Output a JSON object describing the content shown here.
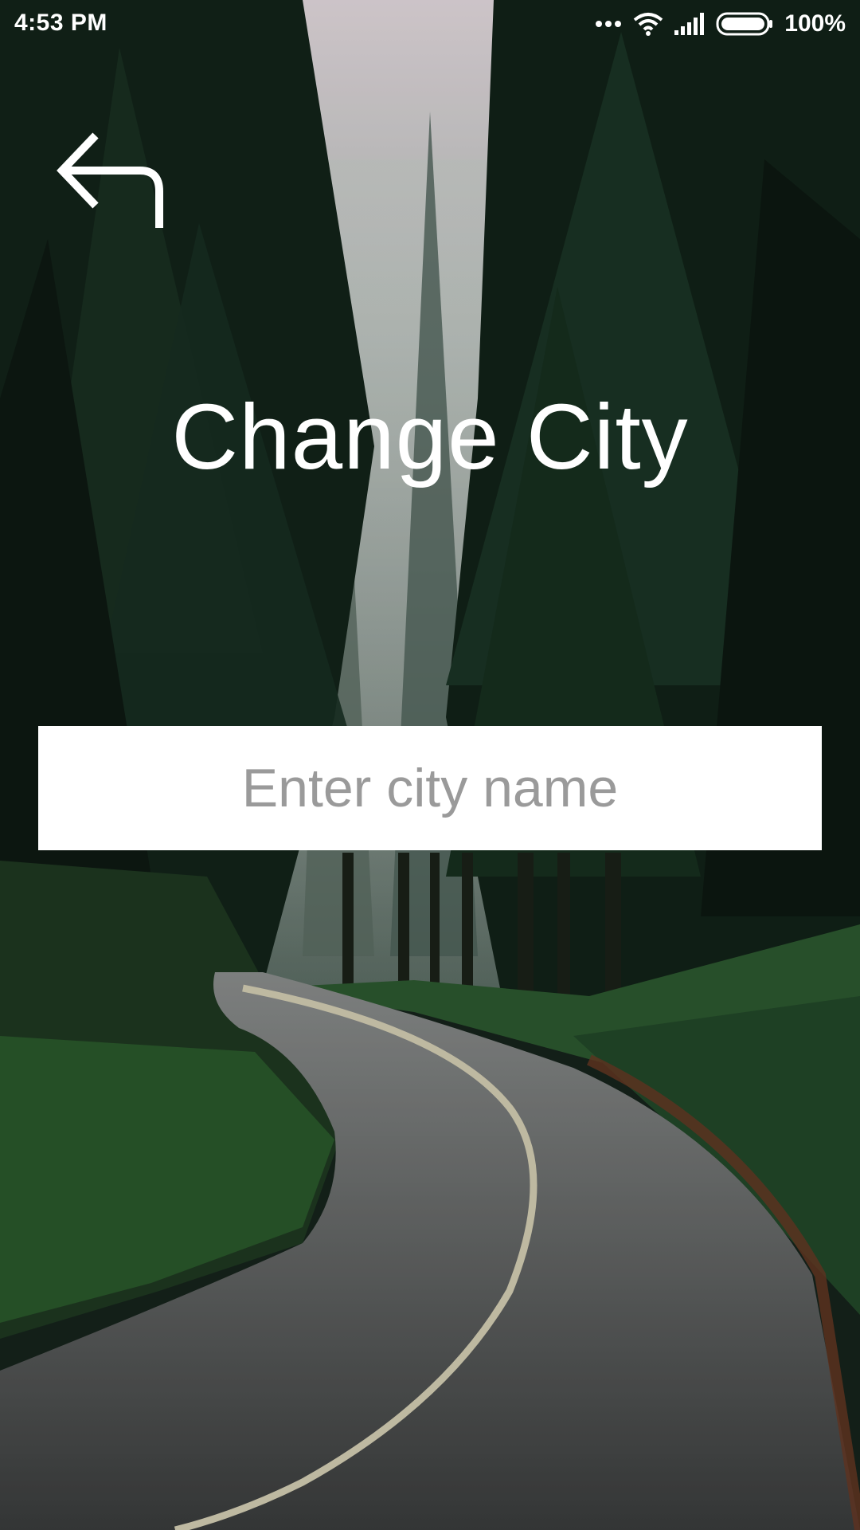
{
  "status_bar": {
    "time": "4:53 PM",
    "battery_percent": "100%",
    "icons": [
      "more-dots-icon",
      "wifi-icon",
      "signal-icon",
      "battery-icon"
    ]
  },
  "header": {
    "back_icon": "back-arrow-icon",
    "title": "Change City"
  },
  "search": {
    "placeholder": "Enter city name",
    "value": ""
  },
  "colors": {
    "title_text": "#ffffff",
    "input_background": "#ffffff",
    "placeholder_text": "#9a9a9a"
  }
}
